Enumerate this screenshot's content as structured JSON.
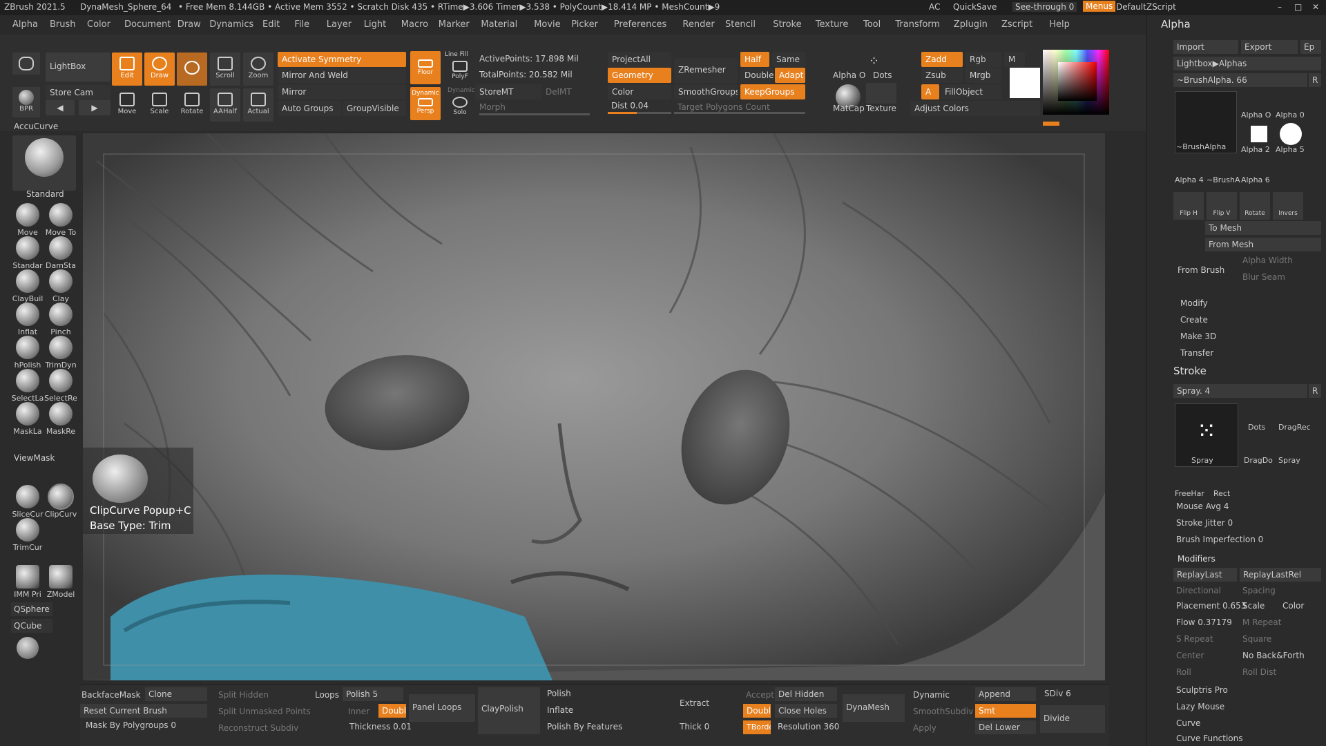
{
  "titlebar": {
    "app": "ZBrush 2021.5",
    "doc": "DynaMesh_Sphere_64",
    "stats": "• Free Mem 8.144GB • Active Mem 3552 • Scratch Disk 435 • RTime▶3.606 Timer▶3.538 • PolyCount▶18.414 MP • MeshCount▶9",
    "ac": "AC",
    "quicksave": "QuickSave",
    "seethrough": "See-through  0",
    "menus": "Menus",
    "zscript": "DefaultZScript"
  },
  "menubar": [
    "Alpha",
    "Brush",
    "Color",
    "Document",
    "Draw",
    "Dynamics",
    "Edit",
    "File",
    "Layer",
    "Light",
    "Macro",
    "Marker",
    "Material",
    "Movie",
    "Picker",
    "Preferences",
    "Render",
    "Stencil",
    "Stroke",
    "Texture",
    "Tool",
    "Transform",
    "Zplugin",
    "Zscript",
    "Help"
  ],
  "toolbar": {
    "lightbox": "LightBox",
    "storecam": "Store Cam",
    "bpr": "BPR",
    "edit": "Edit",
    "draw": "Draw",
    "move": "Move",
    "scale": "Scale",
    "rotate": "Rotate",
    "scroll": "Scroll",
    "zoom": "Zoom",
    "aahalf": "AAHalf",
    "actual": "Actual",
    "activate_symmetry": "Activate Symmetry",
    "mirror_weld": "Mirror And Weld",
    "mirror": "Mirror",
    "auto_groups": "Auto Groups",
    "group_visible": "GroupVisible",
    "floor": "Floor",
    "persp": "Persp",
    "dynamic": "Dynamic",
    "linefill": "Line Fill",
    "polyf": "PolyF",
    "solo": "Solo",
    "active_points": "ActivePoints: 17.898 Mil",
    "total_points": "TotalPoints: 20.582 Mil",
    "storemt": "StoreMT",
    "delmt": "DelMT",
    "morph": "Morph",
    "projectall": "ProjectAll",
    "geometry": "Geometry",
    "color": "Color",
    "dist": "Dist 0.04",
    "zremesher": "ZRemesher",
    "smoothgroups": "SmoothGroups",
    "target_polys": "Target Polygons Count",
    "half": "Half",
    "same": "Same",
    "double": "Double",
    "adapt": "Adapt",
    "keepgroups": "KeepGroups",
    "alpha_off": "Alpha O",
    "dots": "Dots",
    "matcap": "MatCap",
    "texture": "Texture",
    "zadd": "Zadd",
    "rgb": "Rgb",
    "m": "M",
    "zsub": "Zsub",
    "mrgb": "Mrgb",
    "a": "A",
    "fillobject": "FillObject",
    "adjust_colors": "Adjust Colors"
  },
  "leftshelf": {
    "accucurve": "AccuCurve",
    "standard": "Standard",
    "brushes": [
      "Move",
      "Move To",
      "Standar",
      "DamSta",
      "ClayBuil",
      "Clay",
      "Inflat",
      "Pinch",
      "hPolish",
      "TrimDyn",
      "SelectLa",
      "SelectRe",
      "MaskLa",
      "MaskRe"
    ],
    "viewmask": "ViewMask",
    "curves": [
      "SliceCur",
      "ClipCurv",
      "TrimCur"
    ],
    "imm": "IMM Pri",
    "zmodeler": "ZModel",
    "qsphere": "QSphere",
    "qcube": "QCube"
  },
  "canvas": {
    "tooltip_name": "ClipCurve  Popup+C",
    "tooltip_type": "Base Type: Trim"
  },
  "alpha_panel": {
    "title": "Alpha",
    "import": "Import",
    "export": "Export",
    "ep": "Ep",
    "lightbox": "Lightbox▶Alphas",
    "brushalpha": "~BrushAlpha. 66",
    "r": "R",
    "thumbs": [
      "~BrushAlpha",
      "Alpha O",
      "Alpha 0",
      "Alpha 2",
      "Alpha 5",
      "Alpha 4",
      "~BrushA",
      "Alpha 6"
    ],
    "flip_h": "Flip H",
    "flip_v": "Flip V",
    "rotate": "Rotate",
    "invers": "Invers",
    "to_mesh": "To Mesh",
    "from_mesh": "From Mesh",
    "from_brush": "From Brush",
    "alpha_width": "Alpha Width",
    "blur_seam": "Blur Seam",
    "modify": "Modify",
    "create": "Create",
    "make3d": "Make 3D",
    "transfer": "Transfer"
  },
  "stroke_panel": {
    "title": "Stroke",
    "spray": "Spray. 4",
    "r": "R",
    "thumbs": [
      "Spray",
      "Dots",
      "DragRec",
      "DragDo",
      "Spray",
      "FreeHar",
      "Rect"
    ],
    "mouse_avg": "Mouse Avg 4",
    "stroke_jitter": "Stroke Jitter 0",
    "brush_imperfection": "Brush Imperfection 0",
    "modifiers": "Modifiers",
    "replaylast": "ReplayLast",
    "replaylastrel": "ReplayLastRel",
    "directional": "Directional",
    "spacing": "Spacing",
    "placement": "Placement 0.653",
    "scale": "Scale",
    "color": "Color",
    "flow": "Flow 0.37179",
    "m_repeat": "M Repeat",
    "s_repeat": "S Repeat",
    "square": "Square",
    "center": "Center",
    "no_back_forth": "No Back&Forth",
    "roll": "Roll",
    "roll_dist": "Roll Dist",
    "sculptris": "Sculptris Pro",
    "lazy_mouse": "Lazy Mouse",
    "curve": "Curve",
    "curve_functions": "Curve Functions"
  },
  "bottombar": {
    "backfacemask": "BackfaceMask",
    "clone": "Clone",
    "reset_brush": "Reset Current Brush",
    "mask_polygroups": "Mask By Polygroups 0",
    "split_hidden": "Split Hidden",
    "split_unmasked": "Split Unmasked Points",
    "reconstruct": "Reconstruct Subdiv",
    "loops": "Loops",
    "polish5": "Polish 5",
    "inner": "Inner",
    "double": "Double",
    "thickness": "Thickness 0.01",
    "panel_loops": "Panel Loops",
    "claypolish": "ClayPolish",
    "polish": "Polish",
    "inflate": "Inflate",
    "polish_features": "Polish By Features",
    "extract": "Extract",
    "thick": "Thick 0",
    "accept": "Accept",
    "double2": "Double",
    "tborder": "TBorder",
    "del_hidden": "Del Hidden",
    "close_holes": "Close Holes",
    "resolution": "Resolution 360",
    "dynamesh": "DynaMesh",
    "dynamic": "Dynamic",
    "smoothsubdiv": "SmoothSubdiv",
    "apply": "Apply",
    "append": "Append",
    "smt": "Smt",
    "del_lower": "Del Lower",
    "sdiv": "SDiv 6",
    "divide": "Divide"
  },
  "colors": {
    "accent": "#e8801e",
    "panel": "#2b2b2b",
    "button": "#3a3a3a"
  }
}
